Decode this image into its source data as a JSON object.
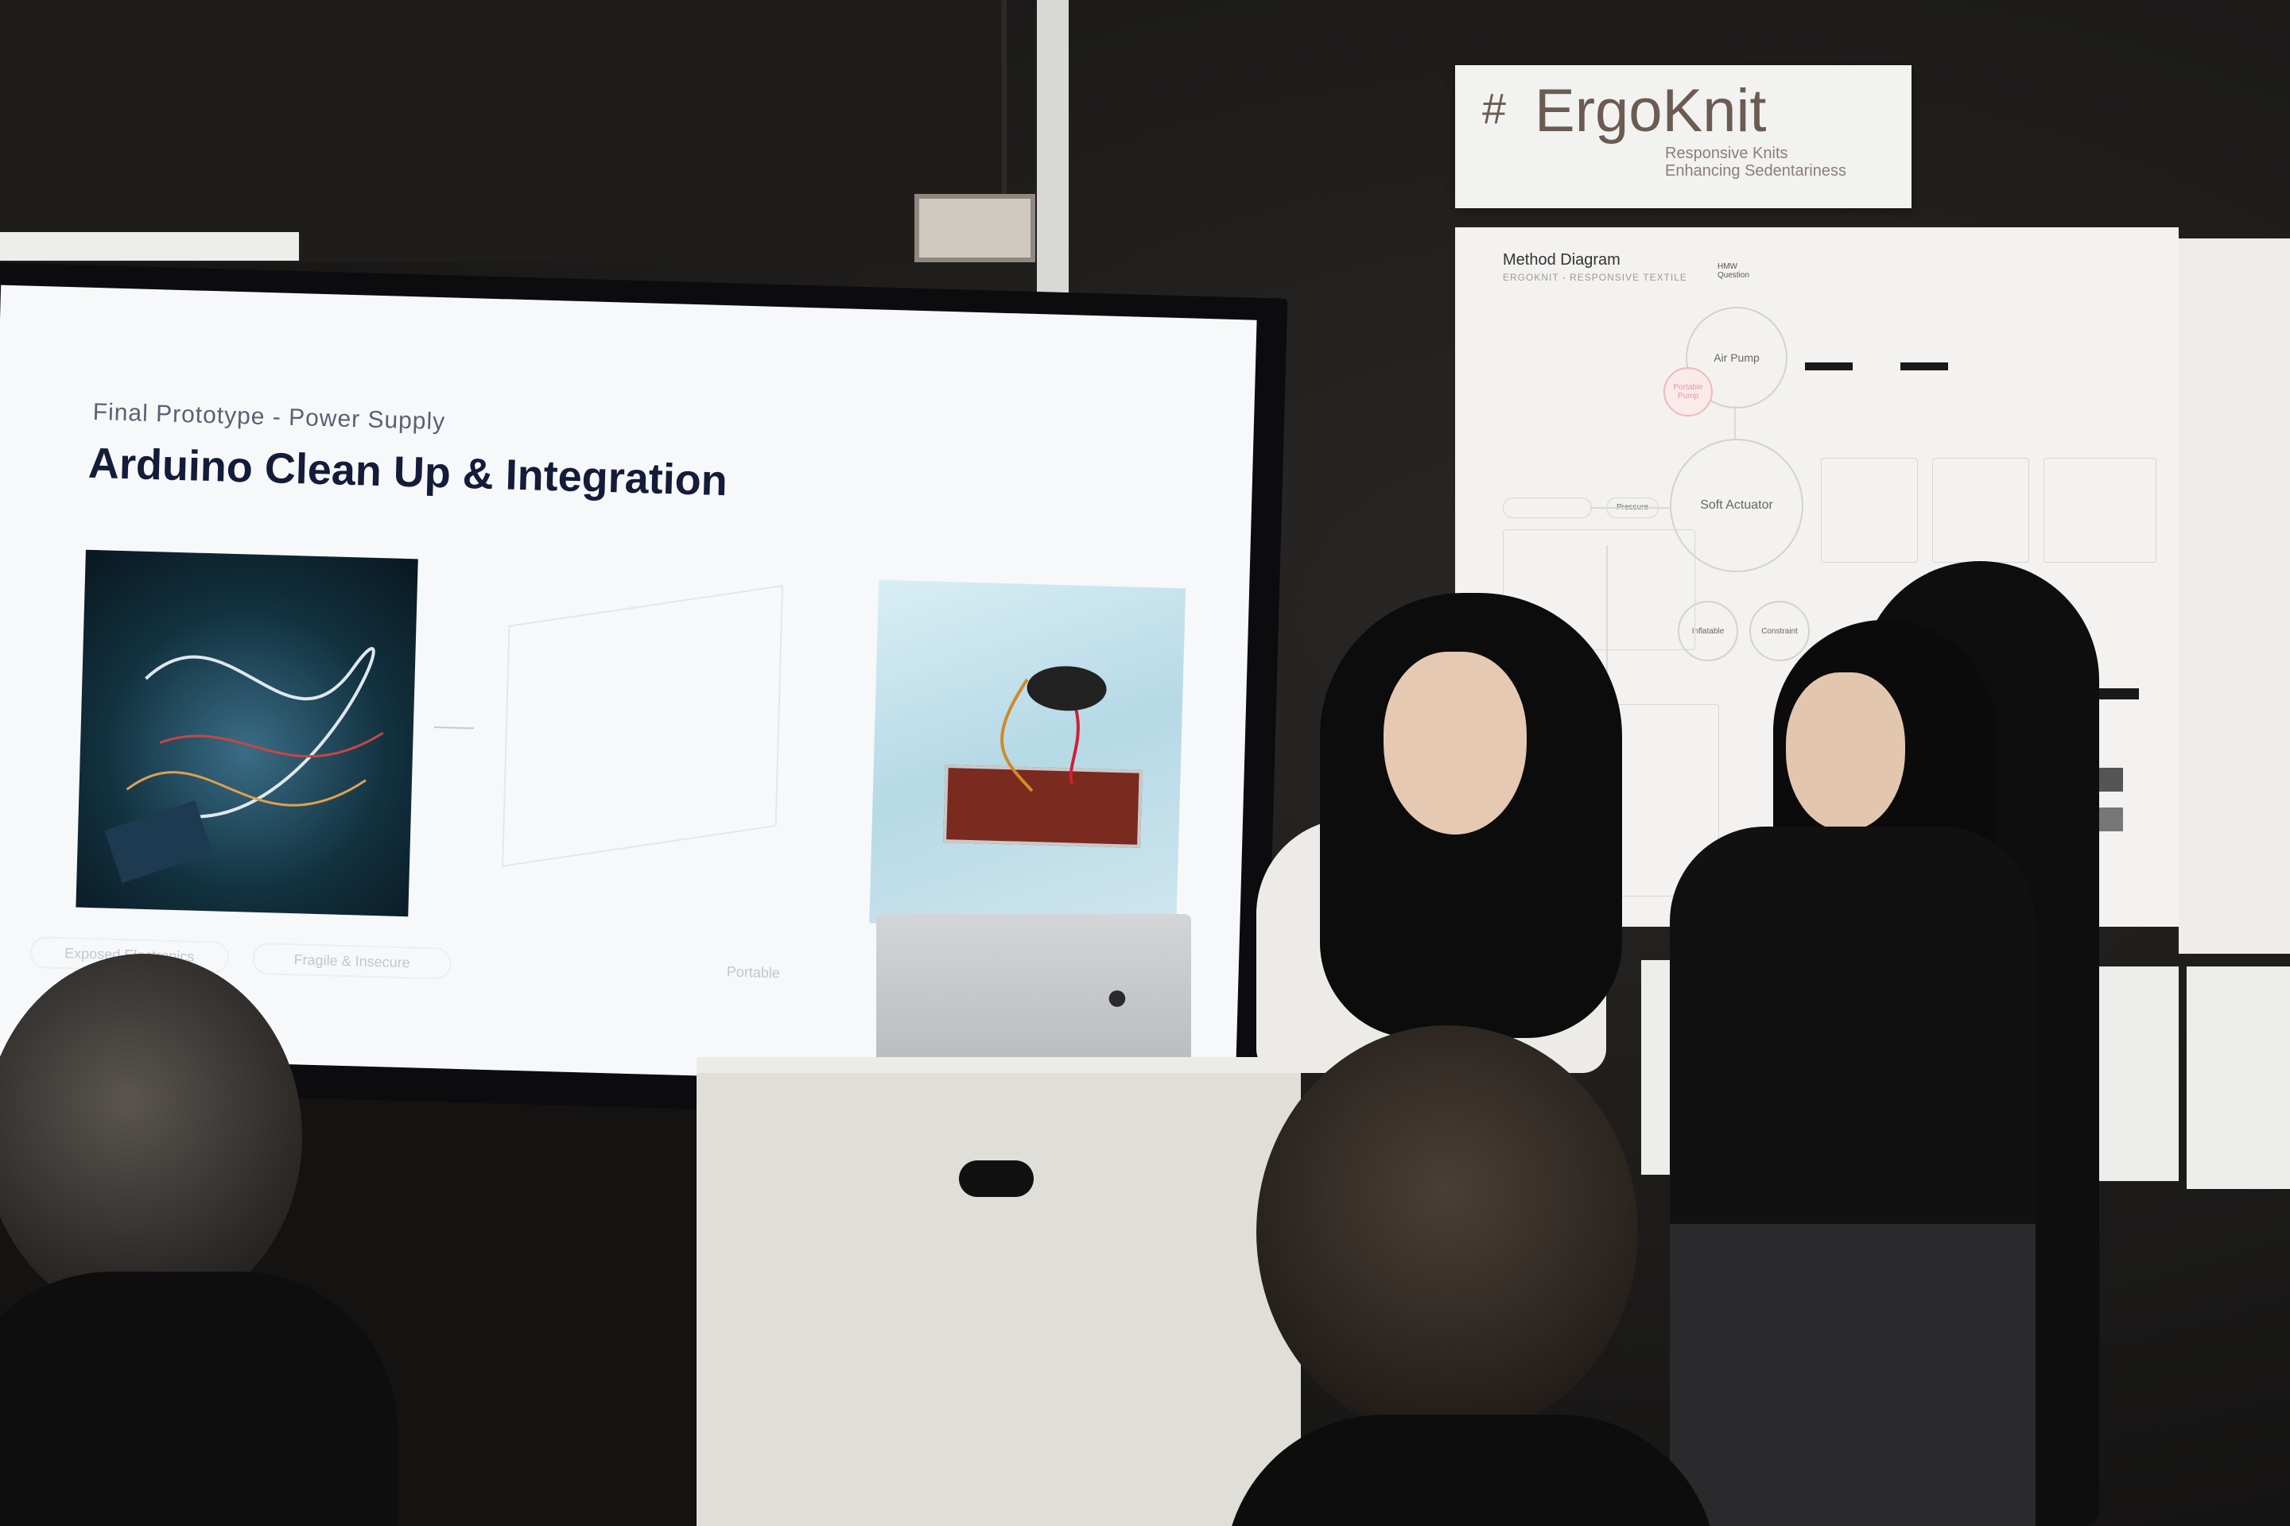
{
  "slide": {
    "subtitle": "Final Prototype - Power Supply",
    "title": "Arduino Clean Up & Integration",
    "labels": [
      "Exposed Electronics",
      "Fragile & Insecure",
      "Portable"
    ]
  },
  "sign": {
    "logo_text": "#",
    "title": "ErgoKnit",
    "tagline_line1": "Responsive Knits",
    "tagline_line2": "Enhancing Sedentariness"
  },
  "poster": {
    "title": "Method Diagram",
    "subtitle": "ERGOKNIT - RESPONSIVE TEXTILE",
    "hmw_label": "HMW Question",
    "nodes": {
      "air_pump": "Air Pump",
      "portable_pump": "Portable Pump",
      "soft_actuator": "Soft Actuator",
      "inflatable": "Inflatable",
      "constraint": "Constraint",
      "pressure": "Pressure"
    }
  },
  "colors": {
    "slide_title": "#141c3a",
    "sign_text": "#6b5b52",
    "accent_pink": "#e49a9a"
  }
}
